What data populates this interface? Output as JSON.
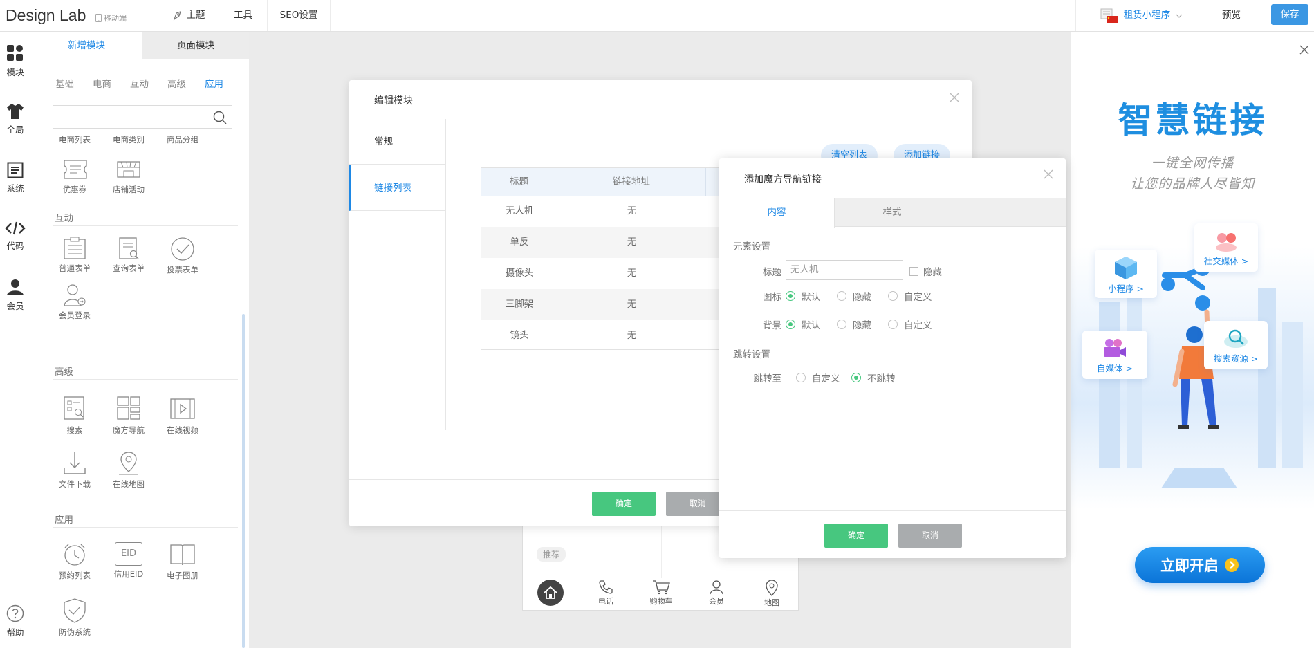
{
  "app": {
    "logo": "Design Lab",
    "mobile_tag": "移动端"
  },
  "topbar": {
    "theme": "主题",
    "tools": "工具",
    "seo": "SEO设置",
    "miniapp": "租赁小程序",
    "preview": "预览",
    "save": "保存"
  },
  "rail": [
    {
      "label": "模块",
      "icon": "grid-icon"
    },
    {
      "label": "全局",
      "icon": "shirt-icon"
    },
    {
      "label": "系统",
      "icon": "list-icon"
    },
    {
      "label": "代码",
      "icon": "code-icon"
    },
    {
      "label": "会员",
      "icon": "user-icon"
    },
    {
      "label": "帮助",
      "icon": "help-icon"
    }
  ],
  "panel": {
    "tabs": [
      "新增模块",
      "页面模块"
    ],
    "categories": [
      "基础",
      "电商",
      "互动",
      "高级",
      "应用"
    ],
    "active_category": "应用",
    "top_partial": [
      "电商列表",
      "电商类别",
      "商品分组"
    ],
    "ecommerce": [
      "优惠券",
      "店铺活动"
    ],
    "sections": {
      "interactive": "互动",
      "advanced": "高级",
      "app": "应用"
    },
    "interactive": [
      "普通表单",
      "查询表单",
      "投票表单",
      "会员登录"
    ],
    "advanced": [
      "搜索",
      "魔方导航",
      "在线视频",
      "文件下载",
      "在线地图"
    ],
    "app": [
      "预约列表",
      "信用EID",
      "电子图册",
      "防伪系统"
    ],
    "eid_text": "EID"
  },
  "phone": {
    "tag": "推荐",
    "nav": [
      "电话",
      "购物车",
      "会员",
      "地图"
    ]
  },
  "promo": {
    "title": "智慧链接",
    "sub1": "一键全网传播",
    "sub2": "让您的品牌人尽皆知",
    "cards": {
      "miniprogram": "小程序 >",
      "social": "社交媒体 >",
      "selfmedia": "自媒体 >",
      "search": "搜索资源 >"
    },
    "start": "立即开启"
  },
  "edit_dialog": {
    "title": "编辑模块",
    "side": [
      "常规",
      "链接列表"
    ],
    "clear": "清空列表",
    "add": "添加链接",
    "table": {
      "headers": [
        "标题",
        "链接地址"
      ],
      "rows": [
        [
          "无人机",
          "无"
        ],
        [
          "单反",
          "无"
        ],
        [
          "摄像头",
          "无"
        ],
        [
          "三脚架",
          "无"
        ],
        [
          "镜头",
          "无"
        ]
      ]
    },
    "ok": "确定",
    "cancel": "取消"
  },
  "nav_dialog": {
    "title": "添加魔方导航链接",
    "tabs": [
      "内容",
      "样式"
    ],
    "section_element": "元素设置",
    "label_title": "标题",
    "title_value": "无人机",
    "hide": "隐藏",
    "label_icon": "图标",
    "label_bg": "背景",
    "options": [
      "默认",
      "隐藏",
      "自定义"
    ],
    "section_jump": "跳转设置",
    "label_jump": "跳转至",
    "jump_options": [
      "自定义",
      "不跳转"
    ],
    "ok": "确定",
    "cancel": "取消"
  },
  "colors": {
    "accent": "#1e88e5",
    "save": "#3b97e3",
    "ok": "#47c77f",
    "cancel": "#a9acae"
  }
}
